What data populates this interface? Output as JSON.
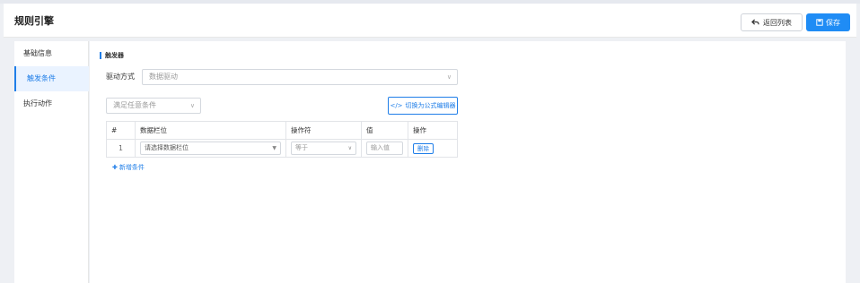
{
  "header": {
    "title": "规则引擎",
    "back_label": "返回列表",
    "save_label": "保存"
  },
  "sidebar": {
    "items": [
      {
        "label": "基础信息"
      },
      {
        "label": "触发条件"
      },
      {
        "label": "执行动作"
      }
    ]
  },
  "trigger": {
    "section_title": "触发器",
    "drive_label": "驱动方式",
    "drive_value": "数据驱动",
    "condition_mode": "满足任意条件",
    "formula_button": "切换为公式编辑器",
    "table": {
      "headers": [
        "#",
        "数据栏位",
        "操作符",
        "值",
        "操作"
      ],
      "rows": [
        {
          "index": "1",
          "field": "请选择数据栏位",
          "operator": "等于",
          "value_placeholder": "输入值",
          "action": "删除"
        }
      ]
    },
    "add_condition": "新增条件"
  },
  "colors": {
    "primary": "#1f8cf5",
    "active_bg": "#eaf3ff"
  }
}
